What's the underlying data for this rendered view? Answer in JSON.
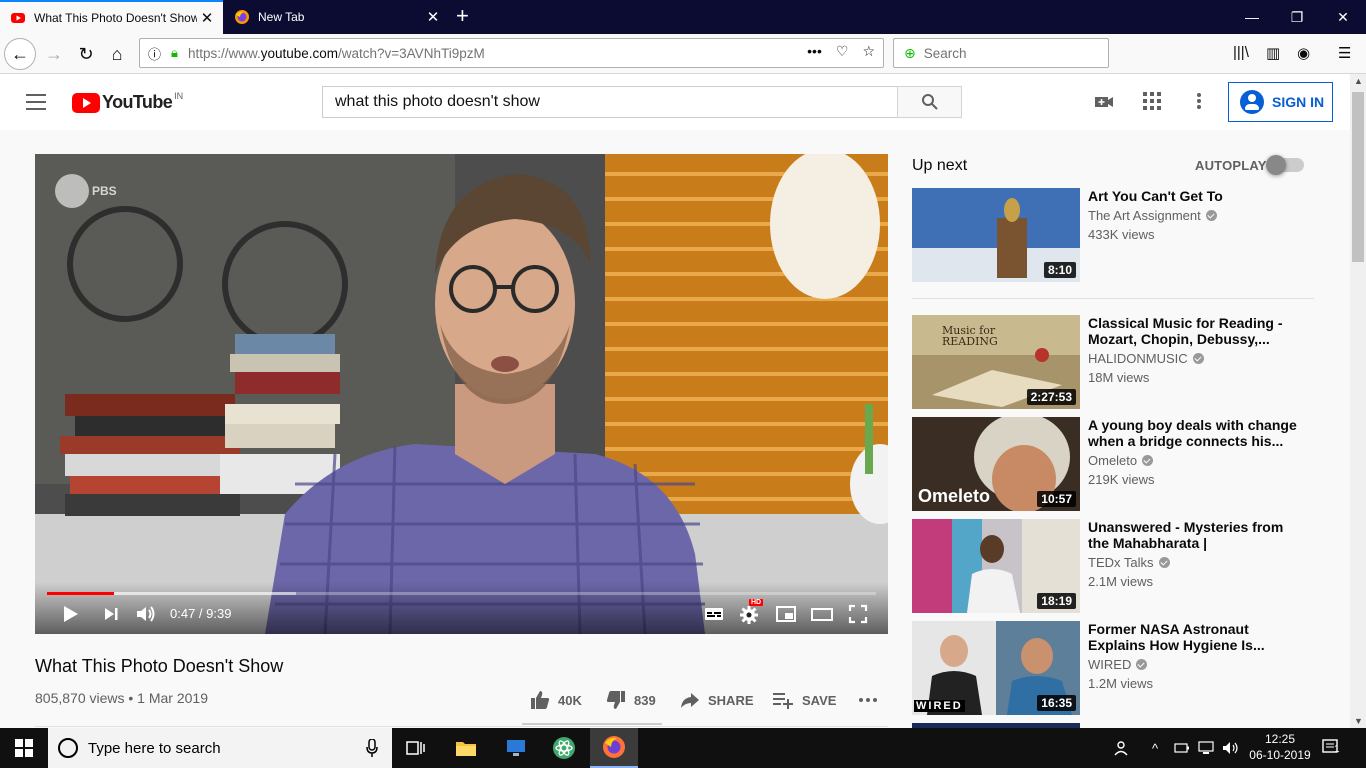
{
  "browser": {
    "tabs": [
      {
        "title": "What This Photo Doesn't Show",
        "active": true
      },
      {
        "title": "New Tab",
        "active": false
      }
    ],
    "url_prefix": "https://www.",
    "url_domain": "youtube.com",
    "url_path": "/watch?v=3AVNhTi9pzM",
    "search_placeholder": "Search"
  },
  "youtube": {
    "region": "IN",
    "logo_text": "YouTube",
    "search_query": "what this photo doesn't show",
    "signin_label": "SIGN IN"
  },
  "player": {
    "watermark": "PBS",
    "time": "0:47 / 9:39",
    "progress_fraction": 0.081,
    "buffered_fraction": 0.3,
    "hd_badge": "HD"
  },
  "video": {
    "title": "What This Photo Doesn't Show",
    "meta": "805,870 views • 1 Mar 2019",
    "likes": "40K",
    "dislikes": "839",
    "share_label": "SHARE",
    "save_label": "SAVE"
  },
  "sidebar": {
    "up_next_label": "Up next",
    "autoplay_label": "AUTOPLAY",
    "autoplay_on": false,
    "items": [
      {
        "title": "Art You Can't Get To",
        "channel": "The Art Assignment",
        "views": "433K views",
        "duration": "8:10"
      },
      {
        "title": "Classical Music for Reading - Mozart, Chopin, Debussy,...",
        "channel": "HALIDONMUSIC",
        "views": "18M views",
        "duration": "2:27:53",
        "thumb_text": "Music for READING"
      },
      {
        "title": "A young boy deals with change when a bridge connects his...",
        "channel": "Omeleto",
        "views": "219K views",
        "duration": "10:57",
        "thumb_text": "Omeleto"
      },
      {
        "title": "Unanswered - Mysteries from the Mahabharata | Christopher...",
        "channel": "TEDx Talks",
        "views": "2.1M views",
        "duration": "18:19"
      },
      {
        "title": "Former NASA Astronaut Explains How Hygiene Is...",
        "channel": "WIRED",
        "views": "1.2M views",
        "duration": "16:35",
        "thumb_text": "WIRED"
      }
    ]
  },
  "taskbar": {
    "search_placeholder": "Type here to search",
    "time": "12:25",
    "date": "06-10-2019",
    "notification_count": "1"
  }
}
